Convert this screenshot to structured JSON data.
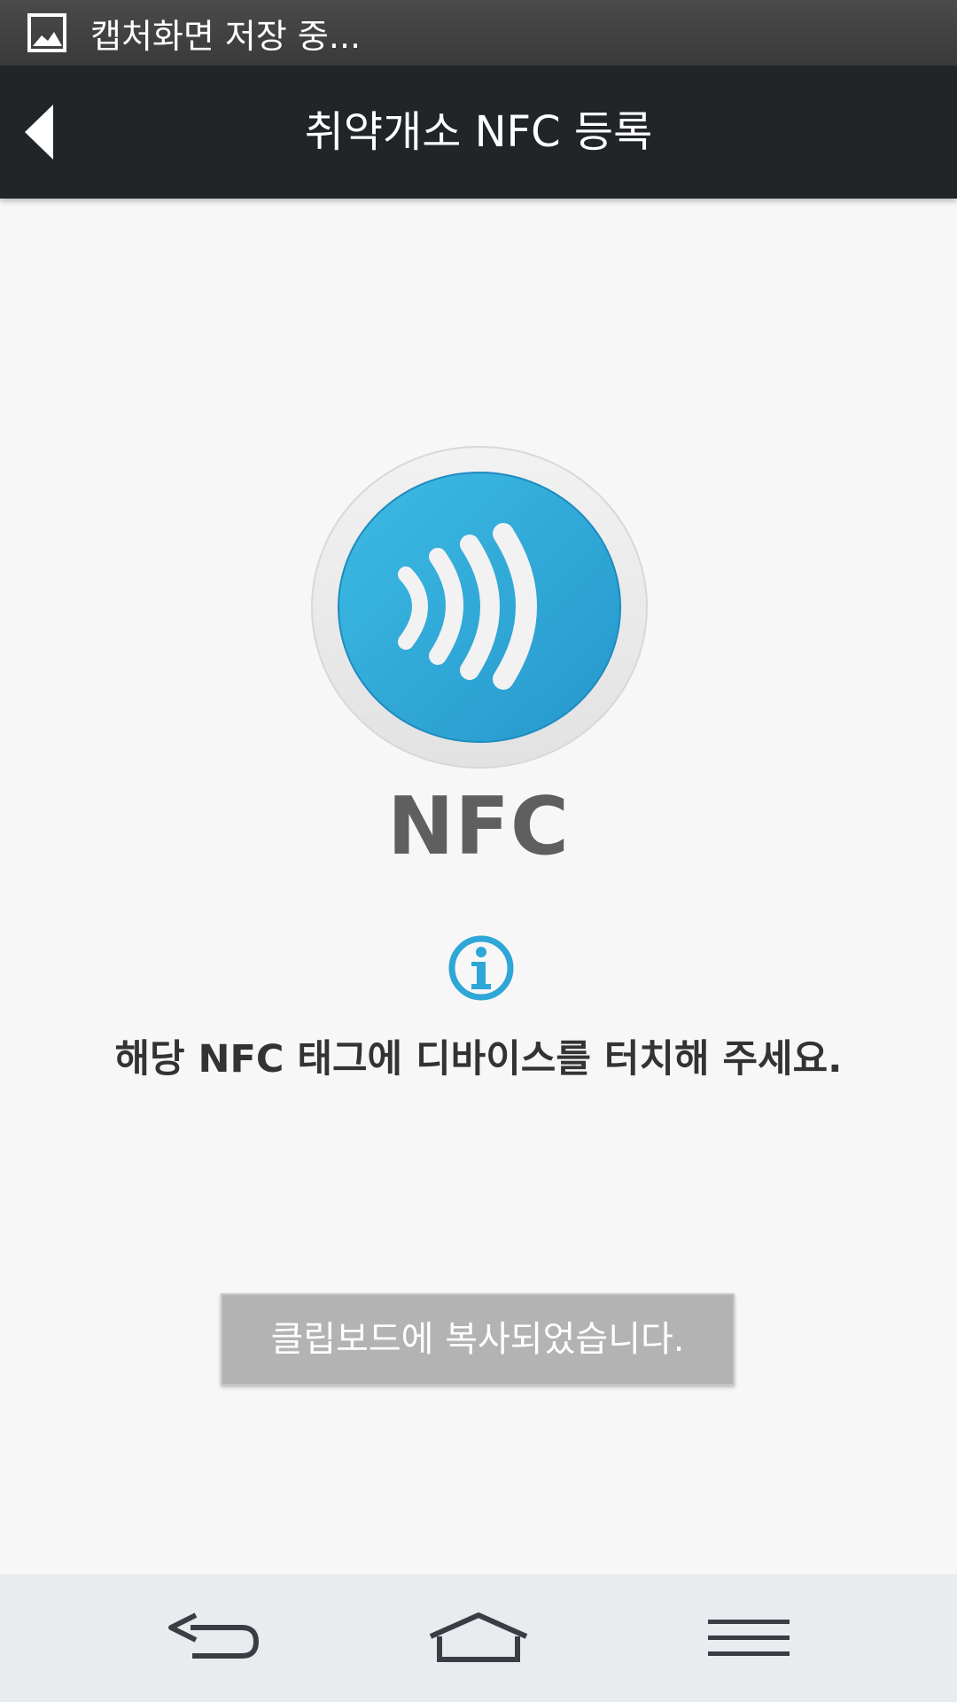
{
  "status_bar": {
    "text": "캡처화면 저장 중...",
    "icon": "image-icon"
  },
  "app_bar": {
    "title": "취약개소 NFC 등록",
    "back_icon": "back-arrow-icon"
  },
  "main": {
    "emblem_icon": "nfc-wave-icon",
    "nfc_label": "NFC",
    "info_icon": "info-icon",
    "instruction": "해당 NFC 태그에 디바이스를 터치해 주세요."
  },
  "toast": {
    "message": "클립보드에 복사되었습니다."
  },
  "nav_bar": {
    "back_icon": "nav-back-icon",
    "home_icon": "nav-home-icon",
    "menu_icon": "nav-menu-icon"
  },
  "colors": {
    "accent": "#2fa6d8",
    "app_bar": "#212528",
    "background": "#f7f7f7",
    "toast": "#b3b3b3"
  }
}
